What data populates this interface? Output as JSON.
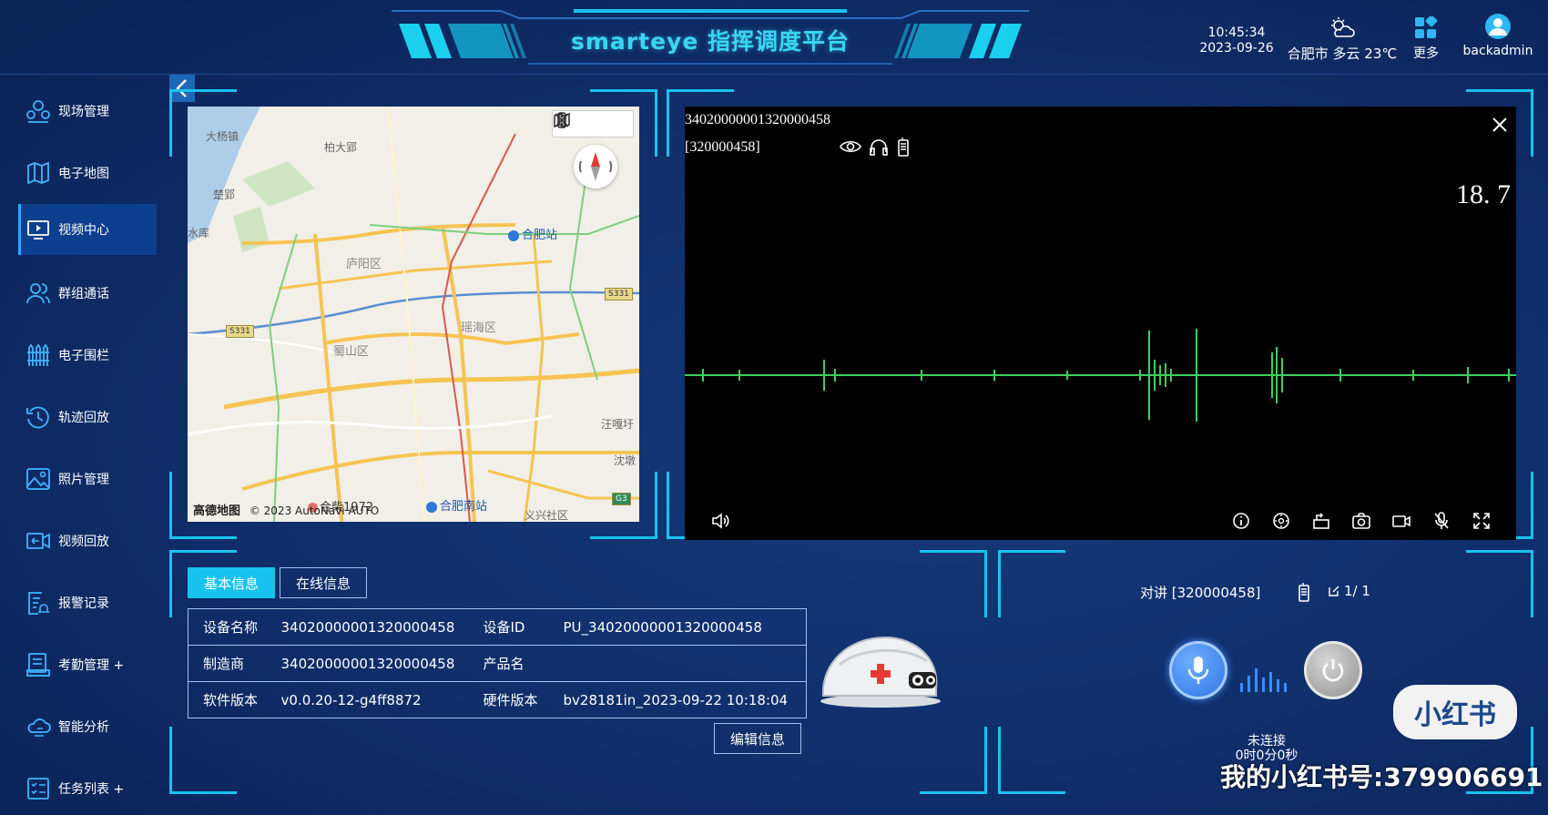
{
  "header": {
    "title": "smarteye 指挥调度平台",
    "time": "10:45:34",
    "date": "2023-09-26",
    "weather": "合肥市 多云 23℃",
    "more_label": "更多",
    "username": "backadmin"
  },
  "sidebar": {
    "items": [
      {
        "label": "现场管理",
        "icon": "team-icon",
        "active": false
      },
      {
        "label": "电子地图",
        "icon": "map-icon",
        "active": false
      },
      {
        "label": "视频中心",
        "icon": "monitor-icon",
        "active": true
      },
      {
        "label": "群组通话",
        "icon": "users-icon",
        "active": false
      },
      {
        "label": "电子围栏",
        "icon": "fence-icon",
        "active": false
      },
      {
        "label": "轨迹回放",
        "icon": "history-icon",
        "active": false
      },
      {
        "label": "照片管理",
        "icon": "photo-icon",
        "active": false
      },
      {
        "label": "视频回放",
        "icon": "video-replay-icon",
        "active": false
      },
      {
        "label": "报警记录",
        "icon": "alarm-record-icon",
        "active": false
      },
      {
        "label": "考勤管理 +",
        "icon": "attendance-icon",
        "active": false
      },
      {
        "label": "智能分析",
        "icon": "cloud-analysis-icon",
        "active": false
      },
      {
        "label": "任务列表 +",
        "icon": "task-list-icon",
        "active": false
      }
    ]
  },
  "map": {
    "labels": [
      "大杨镇",
      "柏大郢",
      "楚郢",
      "水库",
      "合肥站",
      "庐阳区",
      "瑶海区",
      "蜀山区",
      "汪嘎圩",
      "沈墩",
      "合柴1972",
      "合肥南站",
      "义兴社区"
    ],
    "road_shields": [
      "S331",
      "S331",
      "G3"
    ],
    "attribution_logo": "高德地图",
    "attribution": "© 2023 AutoNavi AUTO"
  },
  "video": {
    "device_code": "34020000001320000458",
    "channel": "[320000458]",
    "overlay_number": "18. 7"
  },
  "tabs": {
    "basic": "基本信息",
    "online": "在线信息"
  },
  "device_info": {
    "rows": [
      {
        "k1": "设备名称",
        "v1": "34020000001320000458",
        "k2": "设备ID",
        "v2": "PU_34020000001320000458"
      },
      {
        "k1": "制造商",
        "v1": "34020000001320000458",
        "k2": "产品名",
        "v2": ""
      },
      {
        "k1": "软件版本",
        "v1": "v0.0.20-12-g4ff8872",
        "k2": "硬件版本",
        "v2": "bv28181in_2023-09-22 10:18:04"
      }
    ],
    "edit_label": "编辑信息"
  },
  "intercom": {
    "title": "对讲 [320000458]",
    "count": "1/ 1",
    "status": "未连接",
    "duration": "0时0分0秒"
  },
  "watermark": {
    "logo": "小红书",
    "text": "我的小红书号:379906691"
  },
  "colors": {
    "accent": "#17c3ee",
    "bg": "#0e2a62",
    "active_nav": "#0c3f8e"
  }
}
